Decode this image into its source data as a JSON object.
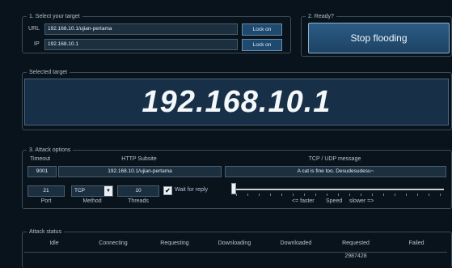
{
  "target": {
    "legend": "1. Select your target",
    "url_label": "URL",
    "url_value": "192.168.10.1/ujian-pertama",
    "ip_label": "IP",
    "ip_value": "192.168.10.1",
    "lock_url": "Lock on",
    "lock_ip": "Lock on"
  },
  "ready": {
    "legend": "2. Ready?",
    "button": "Stop flooding"
  },
  "selected": {
    "legend": "Selected target",
    "value": "192.168.10.1"
  },
  "options": {
    "legend": "3. Attack options",
    "timeout_label": "Timeout",
    "timeout_value": "9001",
    "http_label": "HTTP Subsite",
    "http_value": "192.168.10.1/ujian-pertama",
    "msg_label": "TCP / UDP message",
    "msg_value": "A cat is fine too. Desudesudesu~",
    "port_value": "21",
    "port_label": "Port",
    "method_value": "TCP",
    "method_label": "Method",
    "threads_value": "10",
    "threads_label": "Threads",
    "wait_label": "Wait for reply",
    "wait_checked": true,
    "check_mark": "✔",
    "speed_faster": "<= faster",
    "speed_label": "Speed",
    "speed_slower": "slower =>",
    "speed_position": 0.0,
    "select_arrow": "▼"
  },
  "status": {
    "legend": "Attack status",
    "columns": [
      "Idle",
      "Connecting",
      "Requesting",
      "Downloading",
      "Downloaded",
      "Requested",
      "Failed"
    ],
    "values": [
      "",
      "",
      "",
      "",
      "",
      "2987428",
      ""
    ]
  },
  "colors": {
    "background": "#08131c",
    "accent": "#1f4a70",
    "field": "#1c2f3f"
  }
}
